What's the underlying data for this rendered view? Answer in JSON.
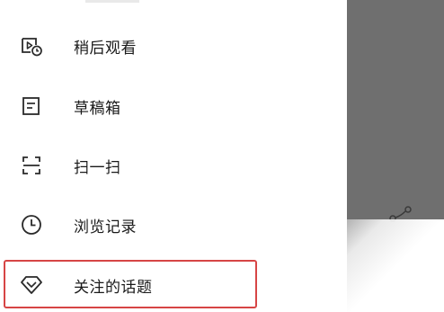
{
  "menu": {
    "items": [
      {
        "label": "稍后观看",
        "icon": "watch-later-icon"
      },
      {
        "label": "草稿箱",
        "icon": "drafts-icon"
      },
      {
        "label": "扫一扫",
        "icon": "scan-icon"
      },
      {
        "label": "浏览记录",
        "icon": "history-clock-icon"
      },
      {
        "label": "关注的话题",
        "icon": "topic-diamond-icon"
      }
    ]
  },
  "colors": {
    "highlight": "#d64545",
    "scrim": "#6f6f6f",
    "text": "#1a1a1a",
    "icon": "#2a2a2a"
  }
}
